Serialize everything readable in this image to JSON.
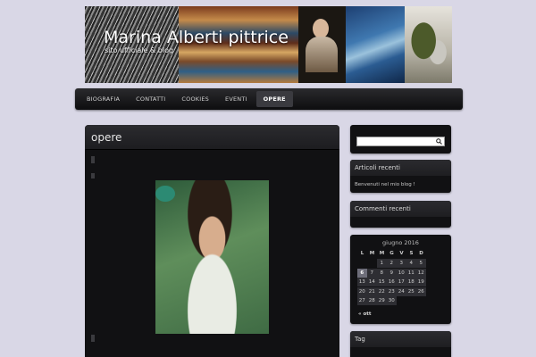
{
  "header": {
    "title": "Marina Alberti pittrice",
    "description": "sito ufficiale & blog"
  },
  "nav": {
    "items": [
      {
        "label": "BIOGRAFIA"
      },
      {
        "label": "CONTATTI"
      },
      {
        "label": "COOKIES"
      },
      {
        "label": "EVENTI"
      },
      {
        "label": "OPERE",
        "active": true
      }
    ]
  },
  "main": {
    "title": "opere"
  },
  "sidebar": {
    "search": {
      "value": ""
    },
    "recent_posts": {
      "title": "Articoli recenti",
      "items": [
        "Benvenuti nel mio blog !"
      ]
    },
    "recent_comments": {
      "title": "Commenti recenti"
    },
    "calendar": {
      "caption": "giugno 2016",
      "weekdays": [
        "L",
        "M",
        "M",
        "G",
        "V",
        "S",
        "D"
      ],
      "leading_blanks": 2,
      "days": [
        "1",
        "2",
        "3",
        "4",
        "5",
        "6",
        "7",
        "8",
        "9",
        "10",
        "11",
        "12",
        "13",
        "14",
        "15",
        "16",
        "17",
        "18",
        "19",
        "20",
        "21",
        "22",
        "23",
        "24",
        "25",
        "26",
        "27",
        "28",
        "29",
        "30"
      ],
      "today": "6",
      "prev": "« ott"
    },
    "tags": {
      "title": "Tag"
    }
  },
  "colors": {
    "page_bg": "#d9d7e6",
    "panel_bg": "#111113",
    "accent_today": "#6e6e7a"
  }
}
